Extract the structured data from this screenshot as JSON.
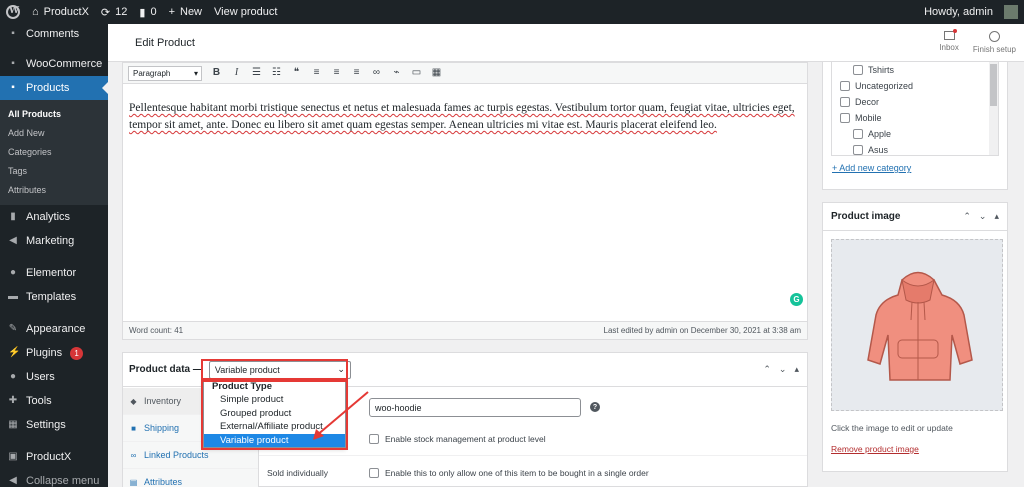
{
  "adminbar": {
    "site_name": "ProductX",
    "updates_count": "12",
    "comments_count": "0",
    "new_label": "New",
    "view_product_label": "View product",
    "howdy": "Howdy, admin"
  },
  "sidebar": {
    "items": [
      {
        "label": "Comments",
        "icon": "comments-icon"
      },
      {
        "label": "WooCommerce",
        "icon": "woocommerce-icon"
      },
      {
        "label": "Products",
        "icon": "products-icon"
      },
      {
        "label": "Analytics",
        "icon": "analytics-icon"
      },
      {
        "label": "Marketing",
        "icon": "marketing-icon"
      },
      {
        "label": "Elementor",
        "icon": "elementor-icon"
      },
      {
        "label": "Templates",
        "icon": "templates-icon"
      },
      {
        "label": "Appearance",
        "icon": "appearance-icon"
      },
      {
        "label": "Plugins",
        "icon": "plugins-icon",
        "badge": "1"
      },
      {
        "label": "Users",
        "icon": "users-icon"
      },
      {
        "label": "Tools",
        "icon": "tools-icon"
      },
      {
        "label": "Settings",
        "icon": "settings-icon"
      },
      {
        "label": "ProductX",
        "icon": "productx-icon"
      },
      {
        "label": "Collapse menu",
        "icon": "collapse-icon"
      }
    ],
    "submenu": [
      "All Products",
      "Add New",
      "Categories",
      "Tags",
      "Attributes"
    ]
  },
  "header": {
    "title": "Edit Product",
    "inbox_label": "Inbox",
    "finish_setup_label": "Finish setup"
  },
  "editor": {
    "format_select": "Paragraph",
    "content": "Pellentesque habitant morbi tristique senectus et netus et malesuada fames ac turpis egestas. Vestibulum tortor quam, feugiat vitae, ultricies eget, tempor sit amet, ante. Donec eu libero sit amet quam egestas semper. Aenean ultricies mi vitae est. Mauris placerat eleifend leo.",
    "word_count": "Word count: 41",
    "last_edited": "Last edited by admin on December 30, 2021 at 3:38 am"
  },
  "product_data": {
    "title": "Product data —",
    "selected_type": "Variable product",
    "dropdown": {
      "group_label": "Product Type",
      "options": [
        "Simple product",
        "Grouped product",
        "External/Affiliate product",
        "Variable product"
      ],
      "selected_index": 3
    },
    "tabs": [
      {
        "label": "Inventory",
        "icon": "inventory-icon"
      },
      {
        "label": "Shipping",
        "icon": "shipping-icon"
      },
      {
        "label": "Linked Products",
        "icon": "link-icon"
      },
      {
        "label": "Attributes",
        "icon": "attributes-icon"
      }
    ],
    "sku_value": "woo-hoodie",
    "stock_management_label": "Enable stock management at product level",
    "sold_individually_label": "Sold individually",
    "sold_individually_desc": "Enable this to only allow one of this item to be bought in a single order"
  },
  "categories": {
    "items": [
      {
        "label": "Tshirts",
        "indent": true
      },
      {
        "label": "Uncategorized",
        "indent": false
      },
      {
        "label": "Decor",
        "indent": false
      },
      {
        "label": "Mobile",
        "indent": false
      },
      {
        "label": "Apple",
        "indent": true
      },
      {
        "label": "Asus",
        "indent": true
      }
    ],
    "add_new_label": "+ Add new category"
  },
  "product_image": {
    "title": "Product image",
    "caption": "Click the image to edit or update",
    "remove_label": "Remove product image"
  },
  "colors": {
    "admin_dark": "#1d2327",
    "accent_blue": "#2271b1",
    "annotation_red": "#e53935",
    "selected_option": "#1e88e5",
    "hoodie": "#f08f7f"
  }
}
